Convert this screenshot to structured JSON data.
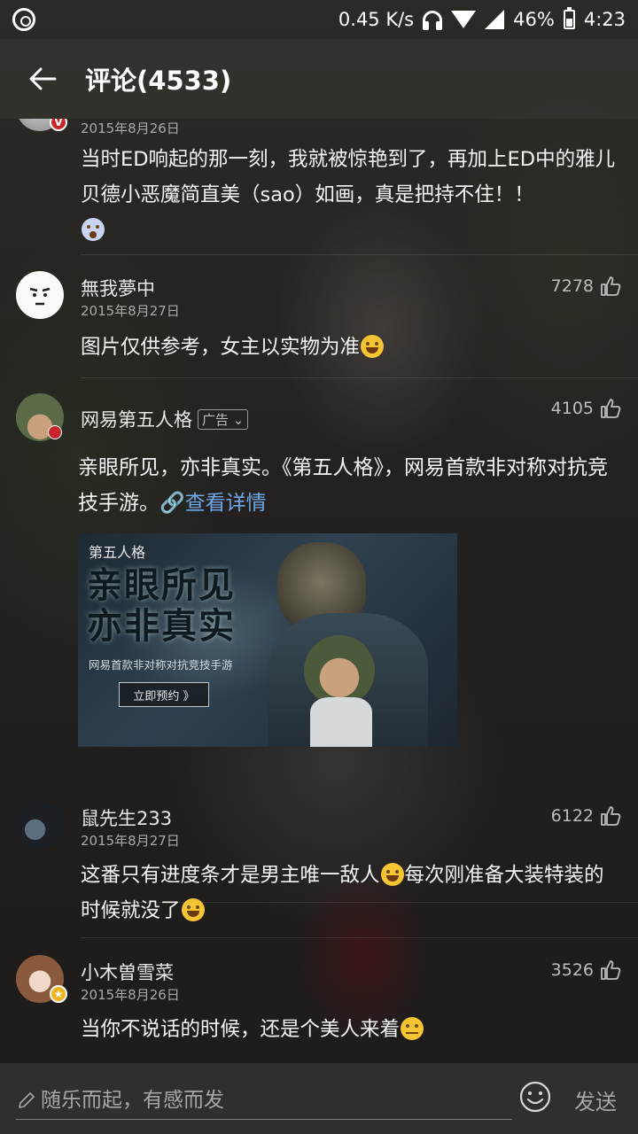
{
  "status_bar": {
    "speed": "0.45 K/s",
    "battery": "46%",
    "time": "4:23"
  },
  "header": {
    "title": "评论(4533)"
  },
  "comments": [
    {
      "date": "2015年8月26日",
      "text": "当时ED响起的那一刻，我就被惊艳到了，再加上ED中的雅儿贝德小恶魔简直美（sao）如画，真是把持不住！！"
    },
    {
      "user": "無我夢中",
      "date": "2015年8月27日",
      "likes": "7278",
      "text": "图片仅供参考，女主以实物为准"
    },
    {
      "user": "网易第五人格",
      "ad_tag": "广告",
      "likes": "4105",
      "text": "亲眼所见，亦非真实。《第五人格》，网易首款非对称对抗竞技手游。",
      "link": "查看详情",
      "ad_image": {
        "brand": "第五人格",
        "headline_1": "亲眼所见",
        "headline_2": "亦非真实",
        "subtitle": "网易首款非对称对抗竞技手游",
        "button": "立即预约 》"
      }
    },
    {
      "user": "鼠先生233",
      "date": "2015年8月27日",
      "likes": "6122",
      "text_1": "这番只有进度条才是男主唯一敌人",
      "text_2": "每次刚准备大装特装的时候就没了"
    },
    {
      "user": "小木曽雪菜",
      "date": "2015年8月26日",
      "likes": "3526",
      "text": "当你不说话的时候，还是个美人来着"
    }
  ],
  "input_bar": {
    "placeholder": "随乐而起，有感而发",
    "send": "发送"
  },
  "colors": {
    "link": "#6ea8e8",
    "vip_badge": "#c8262b",
    "star_badge": "#f2b321"
  }
}
